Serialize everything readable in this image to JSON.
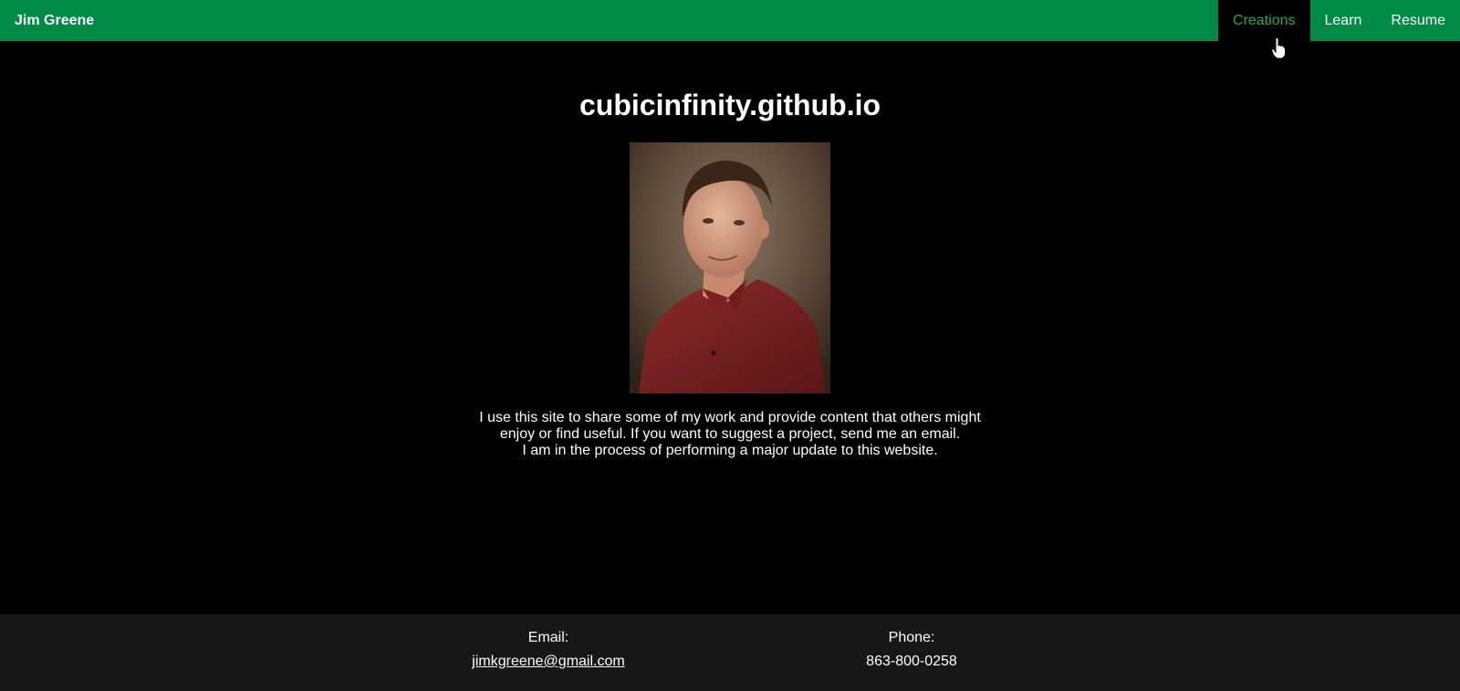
{
  "header": {
    "brand": "Jim Greene",
    "nav": [
      {
        "label": "Creations",
        "active": true
      },
      {
        "label": "Learn",
        "active": false
      },
      {
        "label": "Resume",
        "active": false
      }
    ]
  },
  "main": {
    "title": "cubicinfinity.github.io",
    "intro_lines": [
      "I use this site to share some of my work and provide content that others might",
      "enjoy or find useful. If you want to suggest a project, send me an email.",
      "I am in the process of performing a major update to this website."
    ]
  },
  "footer": {
    "email_label": "Email:",
    "email": "jimkgreene@gmail.com",
    "phone_label": "Phone:",
    "phone": "863-800-0258"
  },
  "colors": {
    "header_bg": "#008a45",
    "active_nav_text": "#1faa5a",
    "page_bg": "#000000",
    "footer_bg": "#171717"
  }
}
